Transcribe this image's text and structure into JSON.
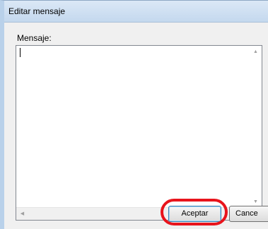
{
  "window": {
    "title": "Editar mensaje"
  },
  "form": {
    "label": "Mensaje:",
    "value": ""
  },
  "scroll_icons": {
    "up": "arrow-up-icon",
    "down": "arrow-down-icon",
    "left": "arrow-left-icon",
    "right": "arrow-right-icon"
  },
  "buttons": {
    "ok_label": "Aceptar",
    "cancel_label": "Cance"
  },
  "colors": {
    "highlight": "#e8141c",
    "dialog_bg": "#f0f0f0",
    "titlebar": "#c4d8ee"
  }
}
